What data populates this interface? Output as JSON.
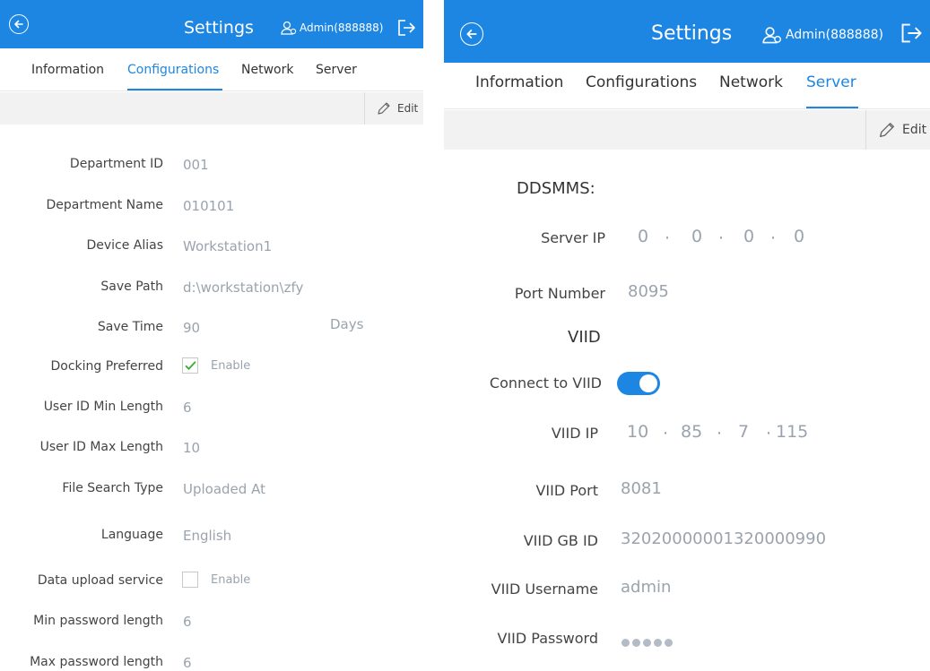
{
  "left": {
    "header": {
      "title": "Settings",
      "user": "Admin(888888)"
    },
    "tabs": [
      "Information",
      "Configurations",
      "Network",
      "Server"
    ],
    "active_tab": "Configurations",
    "edit_label": "Edit",
    "fields": [
      {
        "label": "Department ID",
        "value": "001"
      },
      {
        "label": "Department Name",
        "value": "010101"
      },
      {
        "label": "Device Alias",
        "value": "Workstation1"
      },
      {
        "label": "Save Path",
        "value": "d:\\workstation\\zfy"
      },
      {
        "label": "Save Time",
        "value": "90",
        "unit": "Days"
      },
      {
        "label": "Docking Preferred",
        "checkbox": true,
        "checked": true,
        "value": "Enable"
      },
      {
        "label": "User ID Min Length",
        "value": "6"
      },
      {
        "label": "User ID Max Length",
        "value": "10"
      },
      {
        "label": "File Search Type",
        "value": "Uploaded At"
      },
      {
        "label": "Language",
        "value": "English"
      },
      {
        "label": "Data upload service",
        "checkbox": true,
        "checked": false,
        "value": "Enable"
      },
      {
        "label": "Min password length",
        "value": "6"
      },
      {
        "label": "Max password length",
        "value": "6"
      }
    ]
  },
  "right": {
    "header": {
      "title": "Settings",
      "user": "Admin(888888)"
    },
    "tabs": [
      "Information",
      "Configurations",
      "Network",
      "Server"
    ],
    "active_tab": "Server",
    "edit_label": "Edit",
    "ddsmms_heading": "DDSMMS:",
    "server_ip_label": "Server IP",
    "server_ip": [
      "0",
      "0",
      "0",
      "0"
    ],
    "port_label": "Port Number",
    "port_value": "8095",
    "viid_heading": "VIID",
    "connect_label": "Connect to VIID",
    "connect_enabled": true,
    "viid_ip_label": "VIID IP",
    "viid_ip": [
      "10",
      "85",
      "7",
      "115"
    ],
    "viid_port_label": "VIID Port",
    "viid_port": "8081",
    "viid_gbid_label": "VIID GB ID",
    "viid_gbid": "32020000001320000990",
    "viid_user_label": "VIID Username",
    "viid_user": "admin",
    "viid_pwd_label": "VIID Password",
    "viid_pwd_length": 5
  }
}
